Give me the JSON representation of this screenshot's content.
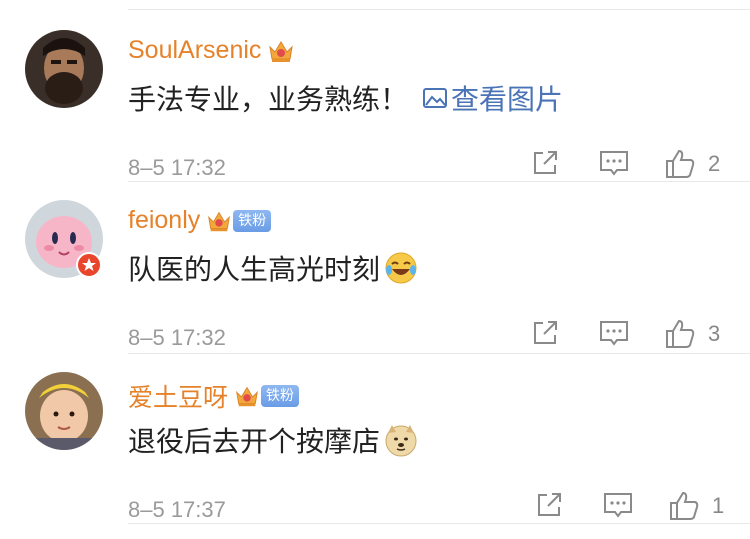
{
  "comments": [
    {
      "username": "SoulArsenic",
      "text": "手法专业，业务熟练！",
      "view_image_label": "查看图片",
      "timestamp": "8–5 17:32",
      "likes": "2",
      "fan_badge": null,
      "avatar_icon": "bearded-warrior-avatar",
      "emoji_icon": null
    },
    {
      "username": "feionly",
      "text": "队医的人生高光时刻",
      "view_image_label": null,
      "timestamp": "8–5 17:32",
      "likes": "3",
      "fan_badge": "铁粉",
      "avatar_icon": "pink-plush-avatar",
      "emoji_icon": "laugh-cry-emoji"
    },
    {
      "username": "爱土豆呀",
      "text": "退役后去开个按摩店",
      "view_image_label": null,
      "timestamp": "8–5 17:37",
      "likes": "1",
      "fan_badge": "铁粉",
      "avatar_icon": "baby-photo-avatar",
      "emoji_icon": "doge-emoji"
    }
  ],
  "colors": {
    "username": "#e5822a",
    "link": "#4a74b6",
    "timestamp": "#9a9a9a",
    "fan_badge_bg": "#7aa7ea",
    "verify_badge": "#e8452c"
  }
}
